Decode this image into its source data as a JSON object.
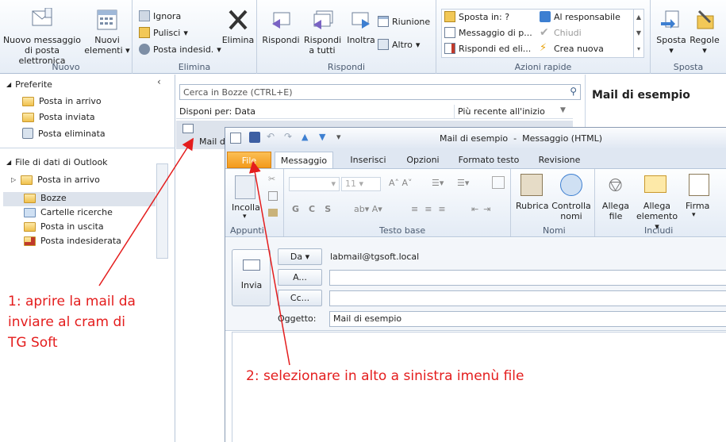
{
  "ribbon": {
    "groups": [
      {
        "label": "Nuovo"
      },
      {
        "label": "Elimina"
      },
      {
        "label": "Rispondi"
      },
      {
        "label": "Azioni rapide"
      },
      {
        "label": "Sposta"
      }
    ],
    "new_email": "Nuovo messaggio di posta elettronica",
    "new_items": "Nuovi elementi",
    "ignore": "Ignora",
    "cleanup": "Pulisci",
    "junk": "Posta indesid.",
    "delete": "Elimina",
    "reply": "Rispondi",
    "reply_all": "Rispondi a tutti",
    "forward": "Inoltra",
    "meeting": "Riunione",
    "more": "Altro",
    "quick": [
      "Sposta in: ?",
      "Messaggio di p...",
      "Rispondi ed eli...",
      "Al responsabile",
      "Chiudi",
      "Crea nuova"
    ],
    "move": "Sposta",
    "rules": "Regole"
  },
  "nav": {
    "favorites": "Preferite",
    "fav_items": [
      "Posta in arrivo",
      "Posta inviata",
      "Posta eliminata"
    ],
    "datafile": "File di dati di Outlook",
    "inbox": "Posta in arrivo",
    "folders": [
      "Bozze",
      "Cartelle ricerche",
      "Posta in uscita",
      "Posta indesiderata"
    ]
  },
  "list": {
    "search_placeholder": "Cerca in Bozze (CTRL+E)",
    "arrange": "Disponi per: Data",
    "order": "Più recente all'inizio",
    "item_subject": "Mail di"
  },
  "reading": {
    "subject": "Mail di esempio"
  },
  "compose": {
    "title": "Mail di esempio  -  Messaggio (HTML)",
    "tabs": [
      "File",
      "Messaggio",
      "Inserisci",
      "Opzioni",
      "Formato testo",
      "Revisione"
    ],
    "paste": "Incolla",
    "font_size": "11",
    "groups": [
      "Appunti",
      "Testo base",
      "Nomi",
      "Includi"
    ],
    "address_book": "Rubrica",
    "check_names": "Controlla nomi",
    "attach_file": "Allega file",
    "attach_item": "Allega elemento",
    "signature": "Firma",
    "from_btn": "Da",
    "from_value": "labmail@tgsoft.local",
    "to_btn": "A...",
    "cc_btn": "Cc...",
    "subject_label": "Oggetto:",
    "subject_value": "Mail di esempio",
    "send": "Invia"
  },
  "annotations": {
    "step1": "1: aprire la mail da inviare al cram di TG Soft",
    "step2": "2: selezionare in alto a sinistra imenù file"
  },
  "colors": {
    "annotation": "#e41d1d",
    "file_tab": "#f5a623",
    "selected_folder": "#dde3ec"
  }
}
